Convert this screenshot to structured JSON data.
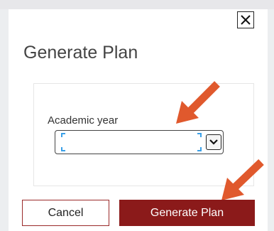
{
  "dialog": {
    "title": "Generate Plan",
    "field_label": "Academic year",
    "select_value": "",
    "cancel_label": "Cancel",
    "generate_label": "Generate Plan"
  },
  "icons": {
    "close": "close-icon",
    "dropdown": "chevron-down-icon",
    "annotation": "arrow-icon"
  },
  "colors": {
    "primary_button": "#8b1a1a",
    "annotation_arrow": "#e0592d",
    "focus_corners": "#3aa0e8"
  }
}
